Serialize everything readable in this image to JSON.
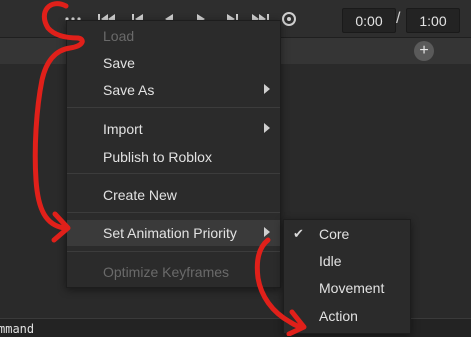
{
  "toolbar": {
    "more_icon": "ellipsis-icon",
    "buttons": [
      "skip-to-start-icon",
      "step-back-icon",
      "play-reverse-icon",
      "play-icon",
      "step-forward-icon",
      "skip-to-end-icon",
      "loop-icon"
    ],
    "current_time": "0:00",
    "separator": "/",
    "end_time": "1:00"
  },
  "header": {
    "add_icon": "plus-icon",
    "add_label": "+"
  },
  "menu": {
    "load": "Load",
    "save": "Save",
    "save_as": "Save As",
    "import": "Import",
    "publish": "Publish to Roblox",
    "create_new": "Create New",
    "set_priority": "Set Animation Priority",
    "optimize": "Optimize Keyframes"
  },
  "submenu": {
    "selected": "Core",
    "items": [
      "Core",
      "Idle",
      "Movement",
      "Action"
    ]
  },
  "bottom": {
    "text": "mmand"
  },
  "colors": {
    "annotation": "#e0201a",
    "menu_bg": "#2b2b2b",
    "highlight": "#3a3a3a"
  }
}
